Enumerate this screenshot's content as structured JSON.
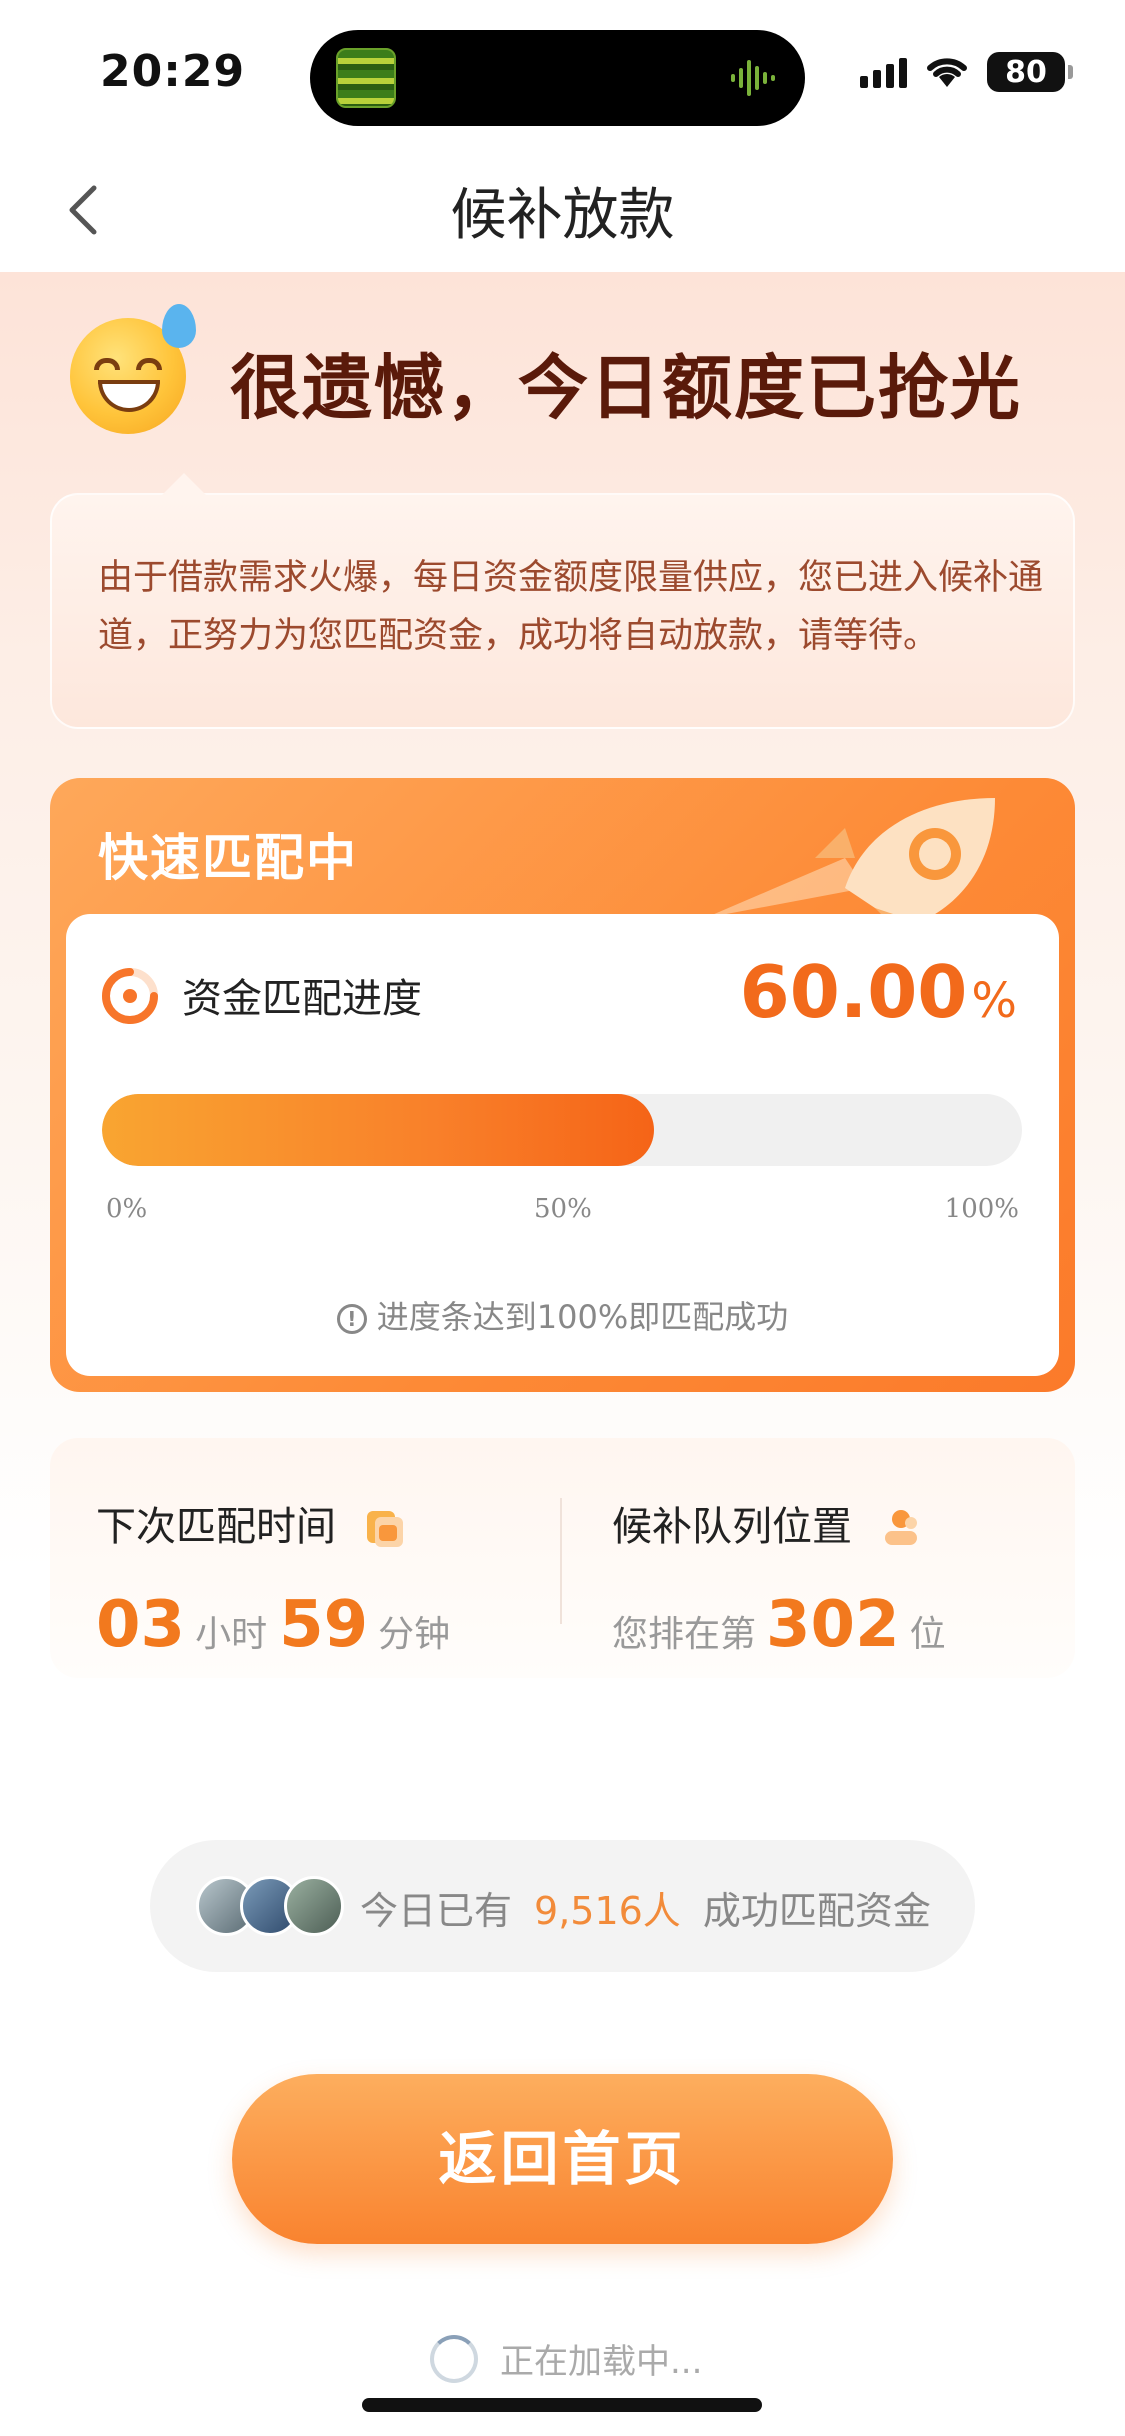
{
  "status_bar": {
    "time": "20:29",
    "battery": "80"
  },
  "nav": {
    "title": "候补放款"
  },
  "headline": {
    "text": "很遗憾，今日额度已抢光"
  },
  "notice": {
    "text": "由于借款需求火爆，每日资金额度限量供应，您已进入候补通道，正努力为您匹配资金，成功将自动放款，请等待。"
  },
  "match": {
    "title": "快速匹配中",
    "progress_label": "资金匹配进度",
    "progress_value": "60.00",
    "progress_unit": "%",
    "progress_fraction": 0.6,
    "ticks": [
      "0%",
      "50%",
      "100%"
    ],
    "note": "进度条达到100%即匹配成功"
  },
  "stats": {
    "next_match": {
      "title": "下次匹配时间",
      "hours": "03",
      "hours_unit": "小时",
      "minutes": "59",
      "minutes_unit": "分钟"
    },
    "queue": {
      "title": "候补队列位置",
      "prefix": "您排在第",
      "position": "302",
      "suffix": "位"
    }
  },
  "today": {
    "prefix": "今日已有",
    "count": "9,516人",
    "suffix": "成功匹配资金"
  },
  "return_button": {
    "label": "返回首页"
  },
  "loading": {
    "text": "正在加载中..."
  },
  "colors": {
    "accent": "#f9832f",
    "progress_start": "#f9a531",
    "progress_end": "#f56417",
    "headline": "#5a1a0a",
    "notice_text": "#9c4a2e"
  }
}
